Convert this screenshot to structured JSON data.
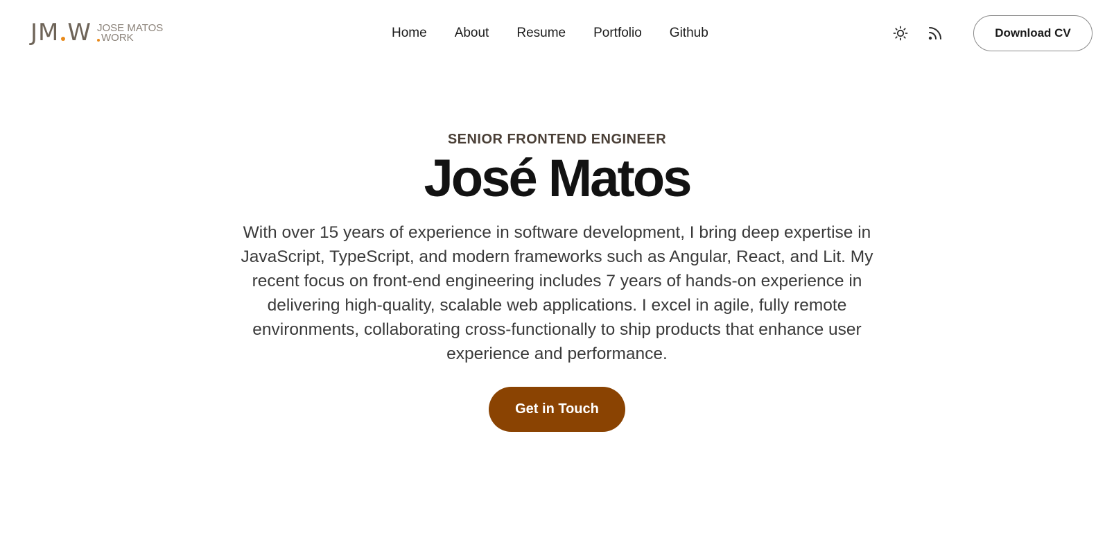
{
  "header": {
    "logo": {
      "mark_left": "JM",
      "mark_right": "W",
      "text_line1": "JOSE MATOS",
      "text_line2": "WORK"
    },
    "nav": [
      {
        "label": "Home"
      },
      {
        "label": "About"
      },
      {
        "label": "Resume"
      },
      {
        "label": "Portfolio"
      },
      {
        "label": "Github"
      }
    ],
    "icons": {
      "theme_toggle": "sun-icon",
      "feed": "rss-icon"
    },
    "download_label": "Download CV"
  },
  "hero": {
    "eyebrow": "SENIOR FRONTEND ENGINEER",
    "name": "José Matos",
    "bio": "With over 15 years of experience in software development, I bring deep expertise in JavaScript, TypeScript, and modern frameworks such as Angular, React, and Lit. My recent focus on front-end engineering includes 7 years of hands-on experience in delivering high-quality, scalable web applications. I excel in agile, fully remote environments, collaborating cross-functionally to ship products that enhance user experience and performance.",
    "cta_label": "Get in Touch"
  },
  "colors": {
    "accent": "#8a4302",
    "logo_dot": "#e8891a",
    "logo_gray": "#6e6458"
  }
}
